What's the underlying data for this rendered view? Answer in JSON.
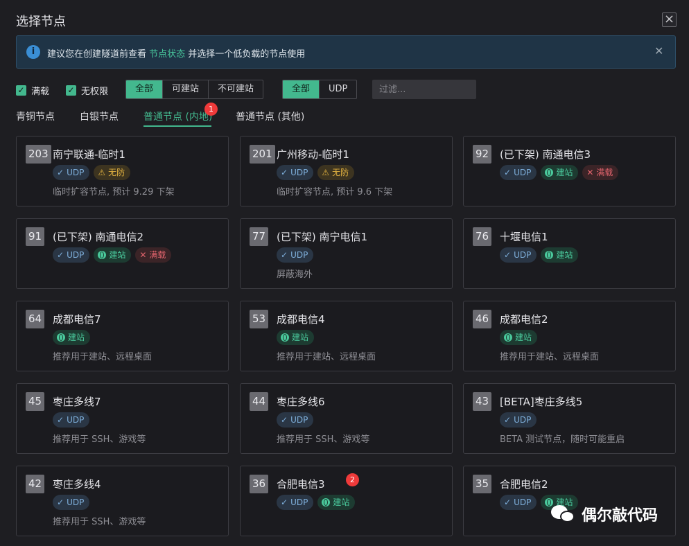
{
  "dialog": {
    "title": "选择节点"
  },
  "alert": {
    "text_before": "建议您在创建隧道前查看 ",
    "link": "节点状态",
    "text_after": " 并选择一个低负载的节点使用"
  },
  "filters": {
    "checkbox_full": "满载",
    "checkbox_noauth": "无权限",
    "build_options": [
      "全部",
      "可建站",
      "不可建站"
    ],
    "protocol_options": [
      "全部",
      "UDP"
    ],
    "search_placeholder": "过滤..."
  },
  "tabs": [
    {
      "label": "青铜节点"
    },
    {
      "label": "白银节点"
    },
    {
      "label": "普通节点 (内地)",
      "badge": "1"
    },
    {
      "label": "普通节点 (其他)"
    }
  ],
  "tag_labels": {
    "udp": "UDP",
    "nodef": "无防",
    "site": "建站",
    "full": "满载"
  },
  "nodes": [
    {
      "id": "203",
      "name": "南宁联通-临时1",
      "tags": [
        "udp",
        "nodef"
      ],
      "desc": "临时扩容节点, 预计 9.29 下架"
    },
    {
      "id": "201",
      "name": "广州移动-临时1",
      "tags": [
        "udp",
        "nodef"
      ],
      "desc": "临时扩容节点, 预计 9.6 下架"
    },
    {
      "id": "92",
      "name": "(已下架) 南通电信3",
      "tags": [
        "udp",
        "site",
        "full"
      ],
      "desc": ""
    },
    {
      "id": "91",
      "name": "(已下架) 南通电信2",
      "tags": [
        "udp",
        "site",
        "full"
      ],
      "desc": ""
    },
    {
      "id": "77",
      "name": "(已下架) 南宁电信1",
      "tags": [
        "udp"
      ],
      "desc": "屏蔽海外"
    },
    {
      "id": "76",
      "name": "十堰电信1",
      "tags": [
        "udp",
        "site"
      ],
      "desc": ""
    },
    {
      "id": "64",
      "name": "成都电信7",
      "tags": [
        "site"
      ],
      "desc": "推荐用于建站、远程桌面"
    },
    {
      "id": "53",
      "name": "成都电信4",
      "tags": [
        "site"
      ],
      "desc": "推荐用于建站、远程桌面"
    },
    {
      "id": "46",
      "name": "成都电信2",
      "tags": [
        "site"
      ],
      "desc": "推荐用于建站、远程桌面"
    },
    {
      "id": "45",
      "name": "枣庄多线7",
      "tags": [
        "udp"
      ],
      "desc": "推荐用于 SSH、游戏等"
    },
    {
      "id": "44",
      "name": "枣庄多线6",
      "tags": [
        "udp"
      ],
      "desc": "推荐用于 SSH、游戏等"
    },
    {
      "id": "43",
      "name": "[BETA]枣庄多线5",
      "tags": [
        "udp"
      ],
      "desc": "BETA 测试节点，随时可能重启"
    },
    {
      "id": "42",
      "name": "枣庄多线4",
      "tags": [
        "udp"
      ],
      "desc": "推荐用于 SSH、游戏等"
    },
    {
      "id": "36",
      "name": "合肥电信3",
      "tags": [
        "udp",
        "site"
      ],
      "desc": "",
      "badge": "2"
    },
    {
      "id": "35",
      "name": "合肥电信2",
      "tags": [
        "udp",
        "site"
      ],
      "desc": ""
    }
  ],
  "watermark": {
    "text": "偶尔敲代码"
  }
}
